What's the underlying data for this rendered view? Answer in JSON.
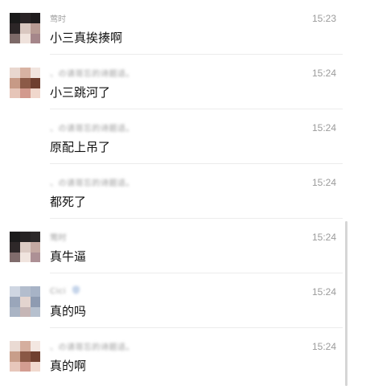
{
  "comments": [
    {
      "name": "莺时",
      "time": "15:23",
      "text": "小三真挨揍啊",
      "avatar_icon": "avatar-dark-hair-icon"
    },
    {
      "name": "、の请哥忘的诗题适。",
      "time": "15:24",
      "text": "小三跳河了",
      "avatar_icon": "avatar-cartoon-couple-icon"
    },
    {
      "name": "、の请哥忘的诗题适。",
      "time": "15:24",
      "text": "原配上吊了",
      "avatar_icon": null
    },
    {
      "name": "、の请哥忘的诗题适。",
      "time": "15:24",
      "text": "都死了",
      "avatar_icon": null
    },
    {
      "name": "莺时",
      "time": "15:24",
      "text": "真牛逼",
      "avatar_icon": "avatar-dark-hair-icon"
    },
    {
      "name": "Cici",
      "time": "15:24",
      "text": "真的吗",
      "avatar_icon": "avatar-photo-icon"
    },
    {
      "name": "、の请哥忘的诗题适。",
      "time": "15:24",
      "text": "真的啊",
      "avatar_icon": "avatar-cartoon-couple-icon"
    }
  ],
  "colors": {
    "timestamp": "#9b9b9b",
    "message_text": "#111111",
    "username": "#a0a0a0",
    "divider": "#ececec",
    "scrollbar": "#d6d6d6",
    "badge": "#c5d4ea"
  }
}
